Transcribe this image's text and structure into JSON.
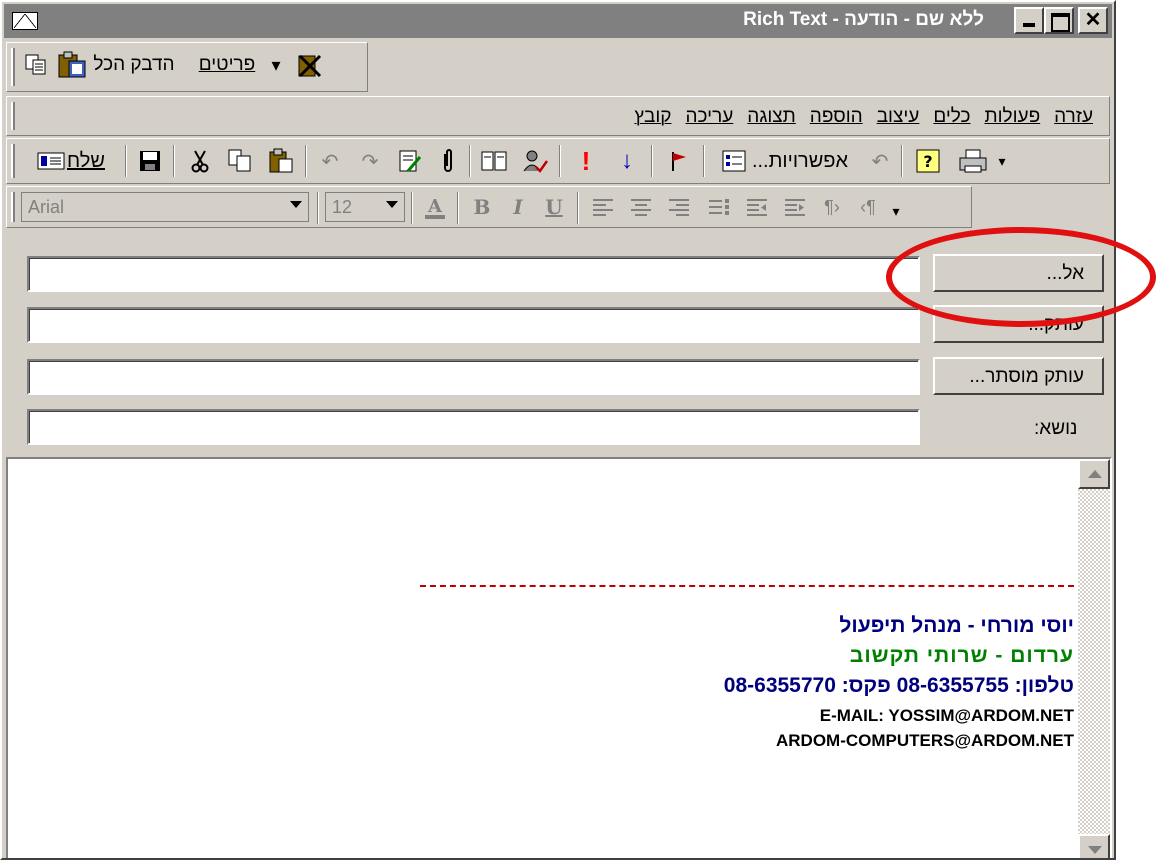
{
  "window": {
    "title": "ללא שם - הודעה - Rich Text",
    "minimize_glyph": "",
    "maximize_glyph": "",
    "close_glyph": "✕"
  },
  "clipboard_toolbar": {
    "paste_all_label": "הדבק הכל",
    "items_label": "פריטים",
    "dropdown_glyph": "▾"
  },
  "menubar": {
    "items": [
      "קובץ",
      "עריכה",
      "תצוגה",
      "הוספה",
      "עיצוב",
      "כלים",
      "פעולות",
      "עזרה"
    ]
  },
  "standard_toolbar": {
    "send_label": "שלח",
    "options_label": "אפשרויות...",
    "importance_high_glyph": "!",
    "importance_low_glyph": "↓"
  },
  "format_toolbar": {
    "font_name": "Arial",
    "font_size": "12",
    "bold": "B",
    "italic": "I",
    "underline": "U"
  },
  "address": {
    "to_label": "אל...",
    "cc_label": "עותק...",
    "bcc_label": "עותק מוסתר...",
    "subject_label": "נושא:",
    "to_value": "",
    "cc_value": "",
    "bcc_value": "",
    "subject_value": ""
  },
  "signature": {
    "name_line": "יוסי מורחי - מנהל תיפעול",
    "company_line": "ערדום - שרותי תקשוב",
    "phone_line": "טלפון: 08-6355755    פקס: 08-6355770",
    "email_line": "E-MAIL:     YOSSIM@ARDOM.NET",
    "email2_line": "ARDOM-COMPUTERS@ARDOM.NET"
  },
  "colors": {
    "highlight": "#e01010",
    "signature_blue": "#00007f",
    "signature_green": "#008000",
    "dashed_rule": "#c00000"
  }
}
